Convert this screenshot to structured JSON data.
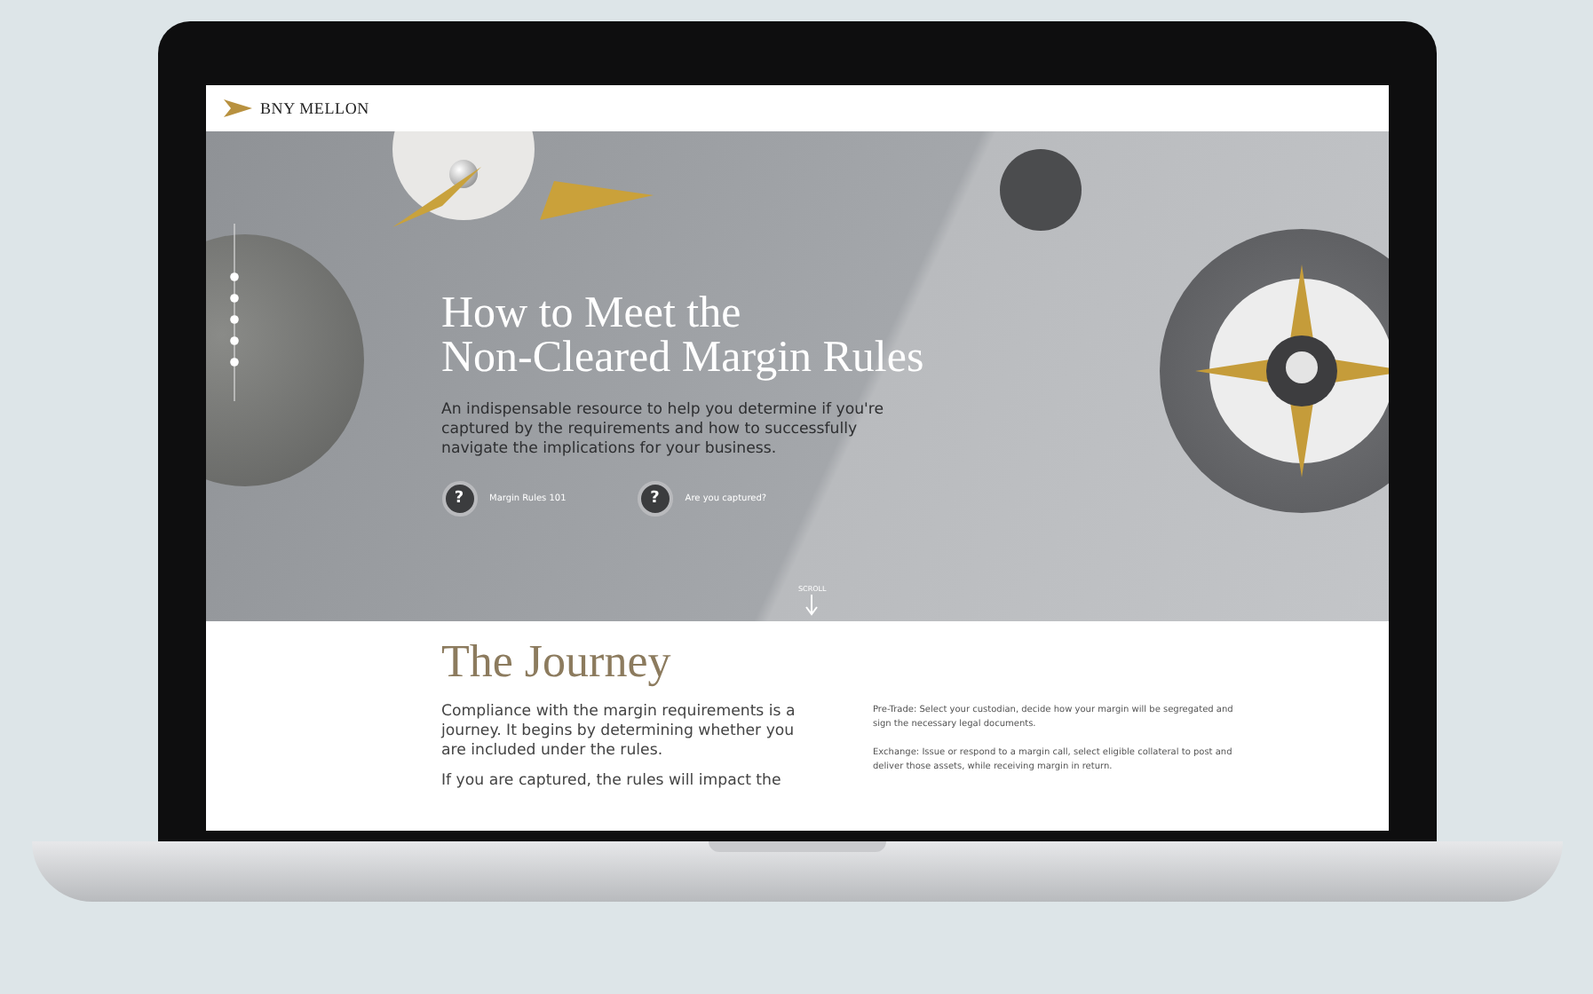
{
  "site_header": {
    "logo_text": "BNY MELLON"
  },
  "hero": {
    "title_lines": [
      "How to Meet the",
      "Non-Cleared Margin Rules"
    ],
    "subtitle": "An indispensable resource to help you determine if you're captured by the requirements and how to successfully navigate the implications for your business.",
    "links": [
      {
        "label": "Margin Rules 101",
        "icon": "?"
      },
      {
        "label": "Are you captured?",
        "icon": "?"
      }
    ],
    "scroll_label": "SCROLL"
  },
  "journey": {
    "title": "The Journey",
    "left_paragraphs": [
      "Compliance with the margin requirements is a journey. It begins by determining whether you are included under the rules.",
      "If you are captured, the rules will impact the"
    ],
    "right_paragraphs": [
      "Pre-Trade: Select your custodian, decide how your margin will be segregated and sign the necessary legal documents.",
      "Exchange: Issue or respond to a margin call, select eligible collateral to post and deliver those assets, while receiving margin in return."
    ]
  }
}
